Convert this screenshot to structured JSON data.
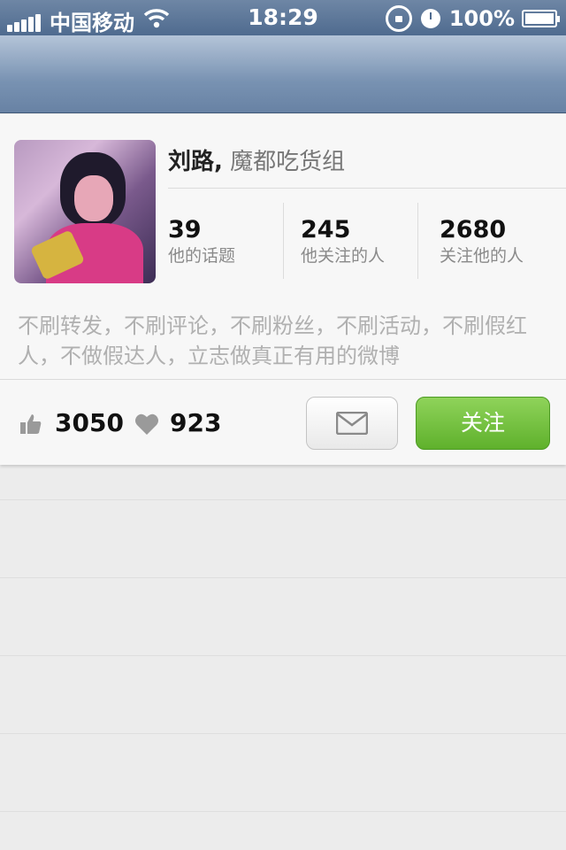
{
  "status_bar": {
    "carrier": "中国移动",
    "time": "18:29",
    "battery": "100%",
    "icons": [
      "signal-icon",
      "wifi-icon",
      "rotation-lock-icon",
      "alarm-icon",
      "battery-icon"
    ]
  },
  "profile": {
    "name": "刘路,",
    "group": "魔都吃货组",
    "stats": [
      {
        "value": "39",
        "label": "他的话题"
      },
      {
        "value": "245",
        "label": "他关注的人"
      },
      {
        "value": "2680",
        "label": "关注他的人"
      }
    ],
    "bio": "不刷转发，不刷评论，不刷粉丝，不刷活动，不刷假红人，不做假达人，立志做真正有用的微博"
  },
  "actions": {
    "likes": "3050",
    "favorites": "923",
    "follow_label": "关注"
  },
  "colors": {
    "nav_bar": "#6882a4",
    "follow_button": "#6cbb36",
    "bio_text": "#b0b0b0"
  }
}
